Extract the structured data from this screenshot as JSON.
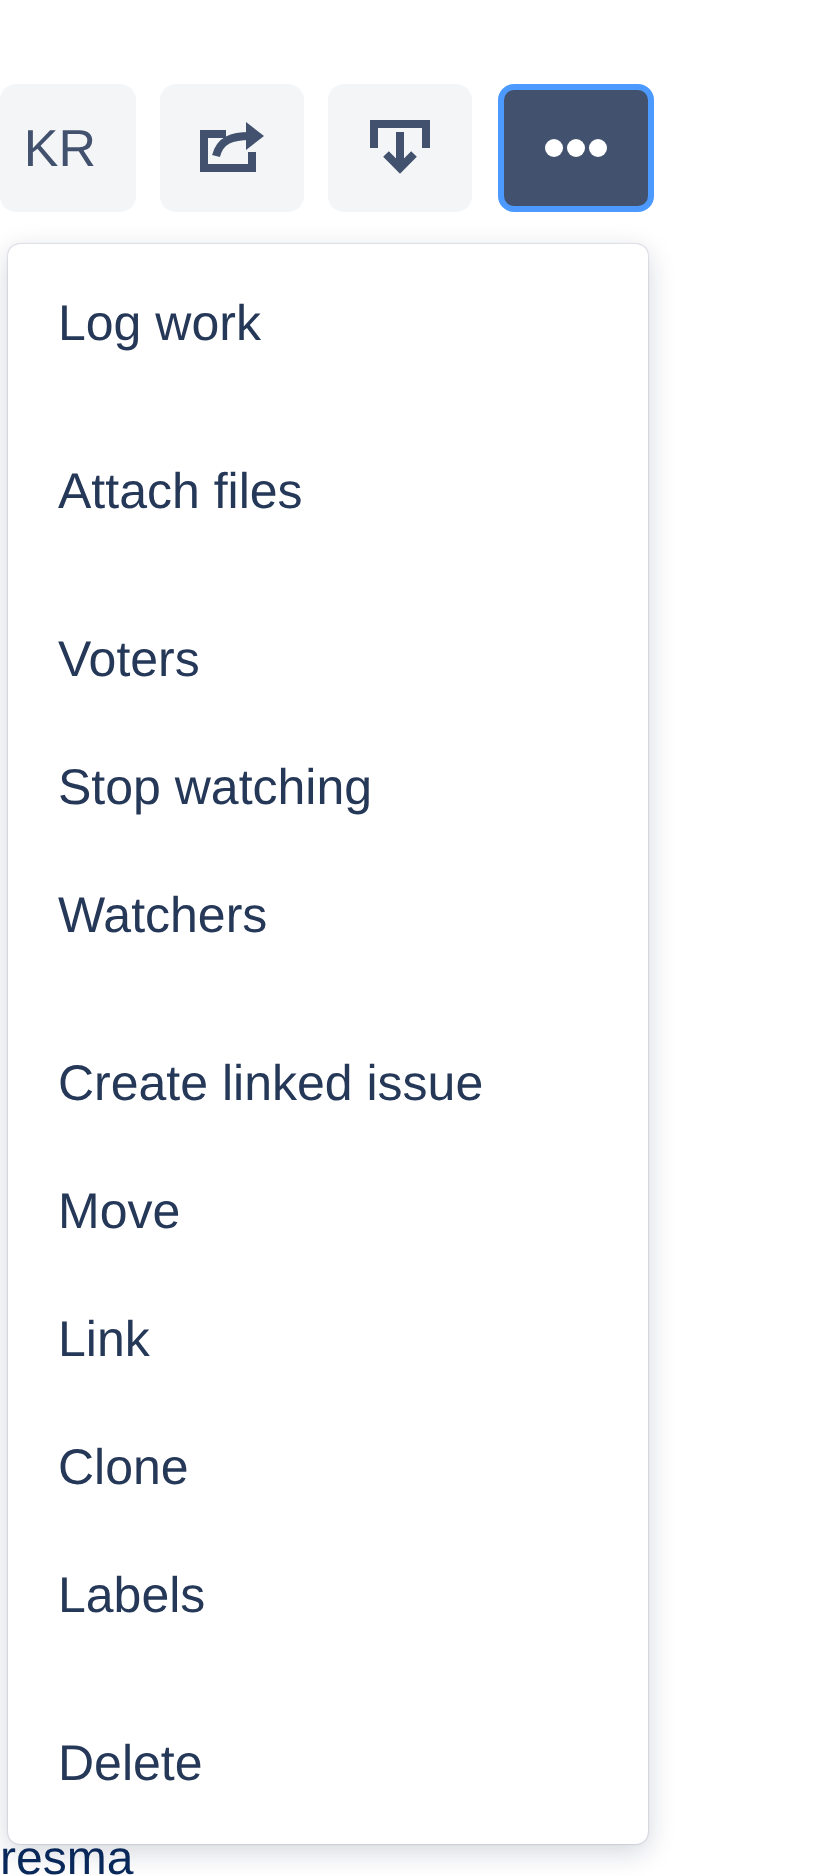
{
  "toolbar": {
    "buttons": [
      {
        "kind": "text",
        "label": "KR"
      },
      {
        "kind": "share"
      },
      {
        "kind": "export"
      },
      {
        "kind": "more",
        "selected": true
      }
    ]
  },
  "menu": {
    "groups": [
      [
        "Log work"
      ],
      [
        "Attach files"
      ],
      [
        "Voters",
        "Stop watching",
        "Watchers"
      ],
      [
        "Create linked issue",
        "Move",
        "Link",
        "Clone",
        "Labels"
      ],
      [
        "Delete"
      ]
    ]
  },
  "background_text": "resma"
}
